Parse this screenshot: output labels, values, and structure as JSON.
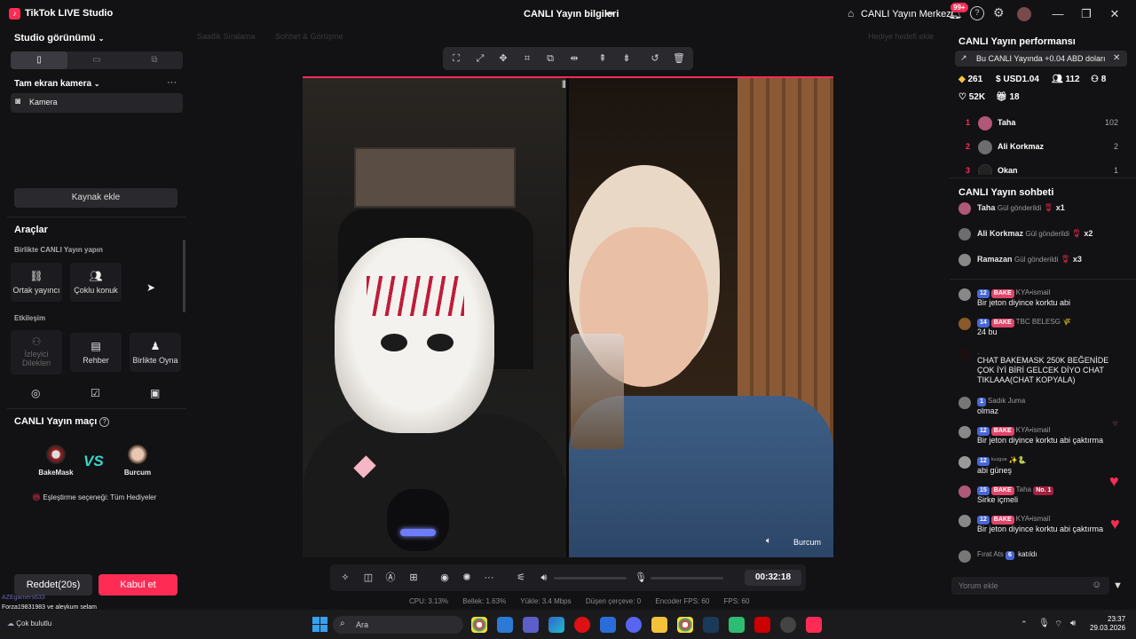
{
  "app": {
    "title": "TikTok LIVE Studio",
    "logo": "♪"
  },
  "header": {
    "live_info": "CANLI Yayın bilgileri",
    "live_center": "CANLI Yayın Merkezi",
    "notif_badge": "99+"
  },
  "left": {
    "studio_view": "Studio görünümü",
    "camera_section": "Tam ekran kamera",
    "camera_item": "Kamera",
    "add_source": "Kaynak ekle",
    "tools_title": "Araçlar",
    "colive_title": "Birlikte CANLI Yayın yapın",
    "colive_tools": [
      {
        "label": "Ortak yayıncı",
        "icon": "link-icon"
      },
      {
        "label": "Çoklu konuk",
        "icon": "guests-icon"
      }
    ],
    "interaction_title": "Etkileşim",
    "interaction_tools": [
      {
        "label": "İzleyici Dilekleri",
        "icon": "wish-icon",
        "disabled": true
      },
      {
        "label": "Rehber",
        "icon": "guide-icon",
        "disabled": false
      },
      {
        "label": "Birlikte Oyna",
        "icon": "play-together-icon",
        "disabled": false
      }
    ],
    "match_title": "CANLI Yayın maçı",
    "match_left": "BakeMask",
    "match_right": "Burcum",
    "match_vs": "VS",
    "match_option": "Eşleştirme seçeneği: Tüm Hediyeler",
    "reject_label": "Reddet(20s)",
    "accept_label": "Kabul et"
  },
  "center": {
    "faded_labels": [
      "Saatlik Sıralama",
      "Sohbet & Görüşme",
      "Hediye hedefi ekle"
    ],
    "guest_name": "Burcum",
    "timer": "00:32:18",
    "stats": [
      "CPU: 3.13%",
      "Bellek: 1.63%",
      "Yükle: 3.4 Mbps",
      "Düşen çerçeve: 0",
      "Encoder FPS: 60",
      "FPS: 60"
    ]
  },
  "right": {
    "perf_title": "CANLI Yayın performansı",
    "perf_note": "Bu CANLI Yayında +0.04 ABD doları",
    "stats": {
      "diamonds": "261",
      "usd": "USD1.04",
      "viewers": "112",
      "gifters": "8",
      "likes": "52K",
      "gifts": "18"
    },
    "ranking": [
      {
        "rank": "1",
        "name": "Taha",
        "value": "102",
        "color": "#b05878"
      },
      {
        "rank": "2",
        "name": "Ali Korkmaz",
        "value": "2",
        "color": "#6d6d70"
      },
      {
        "rank": "3",
        "name": "Okan",
        "value": "1",
        "color": "#222"
      }
    ],
    "chat_title": "CANLI Yayın sohbeti",
    "gifts": [
      {
        "name": "Taha",
        "action": "Gül gönderildi",
        "count": "x1"
      },
      {
        "name": "Ali Korkmaz",
        "action": "Gül gönderildi",
        "count": "x2"
      },
      {
        "name": "Ramazan",
        "action": "Gül gönderildi",
        "count": "x3"
      }
    ],
    "messages": [
      {
        "level": "12",
        "fan": "BAKE",
        "user": "KYA•ismail",
        "text": "Bir jeton diyince korktu abi",
        "extra": ""
      },
      {
        "level": "14",
        "fan": "BAKE",
        "user": "TBC BELESG 🌾",
        "text": "24 bu",
        "extra": ""
      },
      {
        "level": "",
        "fan": "",
        "user": ".",
        "text": "CHAT BAKEMASK 250K BEĞENİDE ÇOK İYİ BİRİ GELCEK DİYO CHAT TIKLAAA(CHAT KOPYALA)",
        "extra": ""
      },
      {
        "level": "1",
        "fan": "",
        "user": "Sadık Juma",
        "text": "olmaz",
        "extra": ""
      },
      {
        "level": "12",
        "fan": "BAKE",
        "user": "KYA•ismail",
        "text": "Bir jeton diyince korktu abi çaktırma",
        "extra": ""
      },
      {
        "level": "12",
        "fan": "",
        "user": "ᵏᵘᶻᵍᵘᶰ ✨🐍",
        "text": "abi güneş",
        "extra": ""
      },
      {
        "level": "15",
        "fan": "BAKE",
        "user": "Taha",
        "text": "Sirke içmeli",
        "extra": "No. 1"
      },
      {
        "level": "12",
        "fan": "BAKE",
        "user": "KYA•ismail",
        "text": "Bir jeton diyince korktu abi çaktırma",
        "extra": ""
      }
    ],
    "joined": {
      "user": "Fırat Ats",
      "level": "6",
      "text": "katıldı"
    },
    "comment_placeholder": "Yorum ekle"
  },
  "taskbar": {
    "search_placeholder": "Ara",
    "time": "23:37",
    "date": "29.03.2026"
  },
  "overlay_chat": [
    "AZEgamers633",
    "Forza19831983 ve aleykum selam",
    "Çok bulutlu"
  ],
  "colors": {
    "accent": "#fe2c55",
    "panel": "#121214",
    "tile": "#1c1c20"
  }
}
